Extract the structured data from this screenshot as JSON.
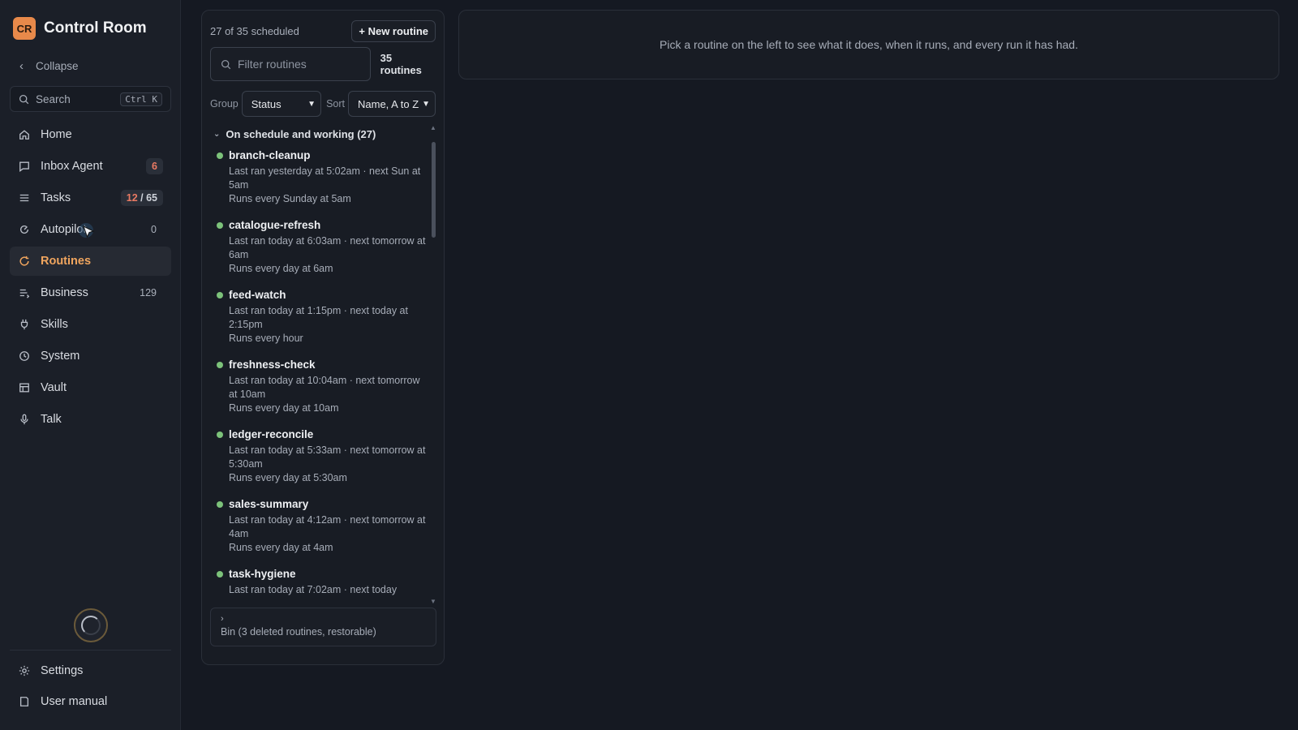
{
  "app": {
    "logo": "CR",
    "title": "Control Room",
    "brand_color": "#e8894a"
  },
  "sidebar": {
    "collapse_label": "Collapse",
    "search": {
      "label": "Search",
      "shortcut": "Ctrl K"
    },
    "items": [
      {
        "label": "Home",
        "icon": "home-icon"
      },
      {
        "label": "Inbox Agent",
        "icon": "message-icon",
        "badge": "6"
      },
      {
        "label": "Tasks",
        "icon": "list-icon",
        "badge_done": "12",
        "badge_sep": " / ",
        "badge_total": "65"
      },
      {
        "label": "Autopilot",
        "icon": "autopilot-icon",
        "badge": "0"
      },
      {
        "label": "Routines",
        "icon": "refresh-icon",
        "active": true
      },
      {
        "label": "Business",
        "icon": "business-icon",
        "badge": "129"
      },
      {
        "label": "Skills",
        "icon": "plug-icon"
      },
      {
        "label": "System",
        "icon": "clock-icon"
      },
      {
        "label": "Vault",
        "icon": "vault-icon"
      },
      {
        "label": "Talk",
        "icon": "mic-icon"
      }
    ],
    "bottom": [
      {
        "label": "Settings",
        "icon": "gear-icon"
      },
      {
        "label": "User manual",
        "icon": "book-icon"
      }
    ]
  },
  "routines_panel": {
    "scheduled_summary": "27 of 35 scheduled",
    "new_button": "+ New routine",
    "filter_placeholder": "Filter routines",
    "total_count": "35 routines",
    "group_label": "Group",
    "group_value": "Status",
    "sort_label": "Sort",
    "sort_value": "Name, A to Z",
    "group_header": "On schedule and working (27)",
    "status_color": "#7cc27a",
    "routines": [
      {
        "name": "branch-cleanup",
        "last_next": "Last ran yesterday at 5:02am · next Sun at 5am",
        "schedule": "Runs every Sunday at 5am"
      },
      {
        "name": "catalogue-refresh",
        "last_next": "Last ran today at 6:03am · next tomorrow at 6am",
        "schedule": "Runs every day at 6am"
      },
      {
        "name": "feed-watch",
        "last_next": "Last ran today at 1:15pm · next today at 2:15pm",
        "schedule": "Runs every hour"
      },
      {
        "name": "freshness-check",
        "last_next": "Last ran today at 10:04am · next tomorrow at 10am",
        "schedule": "Runs every day at 10am"
      },
      {
        "name": "ledger-reconcile",
        "last_next": "Last ran today at 5:33am · next tomorrow at 5:30am",
        "schedule": "Runs every day at 5:30am"
      },
      {
        "name": "sales-summary",
        "last_next": "Last ran today at 4:12am · next tomorrow at 4am",
        "schedule": "Runs every day at 4am"
      },
      {
        "name": "task-hygiene",
        "last_next": "Last ran today at 7:02am · next today",
        "schedule": ""
      }
    ],
    "bin_label": "Bin (3 deleted routines, restorable)"
  },
  "detail": {
    "placeholder": "Pick a routine on the left to see what it does, when it runs, and every run it has had."
  }
}
